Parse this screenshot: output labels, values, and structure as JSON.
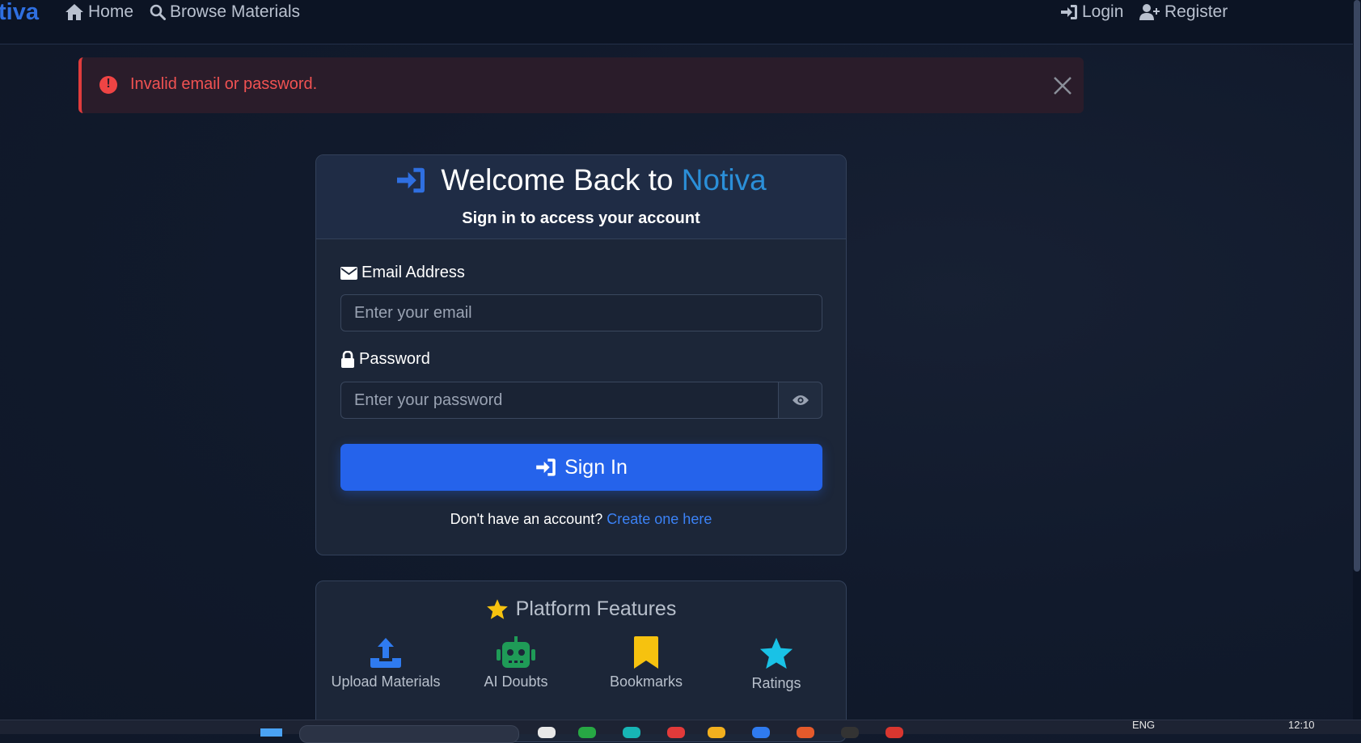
{
  "navbar": {
    "brand": "tiva",
    "home": "Home",
    "browse": "Browse Materials",
    "login": "Login",
    "register": "Register"
  },
  "alert": {
    "message": "Invalid email or password."
  },
  "login_card": {
    "title_prefix": "Welcome Back to ",
    "title_brand": "Notiva",
    "subtitle": "Sign in to access your account",
    "email_label": "Email Address",
    "email_placeholder": "Enter your email",
    "password_label": "Password",
    "password_placeholder": "Enter your password",
    "signin_label": "Sign In",
    "no_account_text": "Don't have an account?",
    "create_link": "Create one here"
  },
  "features": {
    "title": "Platform Features",
    "items": [
      {
        "label": "Upload Materials",
        "icon": "upload-icon",
        "color": "#2f7bf0"
      },
      {
        "label": "AI Doubts",
        "icon": "robot-icon",
        "color": "#1f9b57"
      },
      {
        "label": "Bookmarks",
        "icon": "bookmark-icon",
        "color": "#f6c20f"
      },
      {
        "label": "Ratings",
        "icon": "star-icon",
        "color": "#19c2e6"
      }
    ]
  },
  "taskbar": {
    "lang": "ENG",
    "time": "12:10"
  },
  "colors": {
    "accent": "#2563eb",
    "brand": "#2b8fd8",
    "error": "#ef4444",
    "background": "#111a2c"
  }
}
